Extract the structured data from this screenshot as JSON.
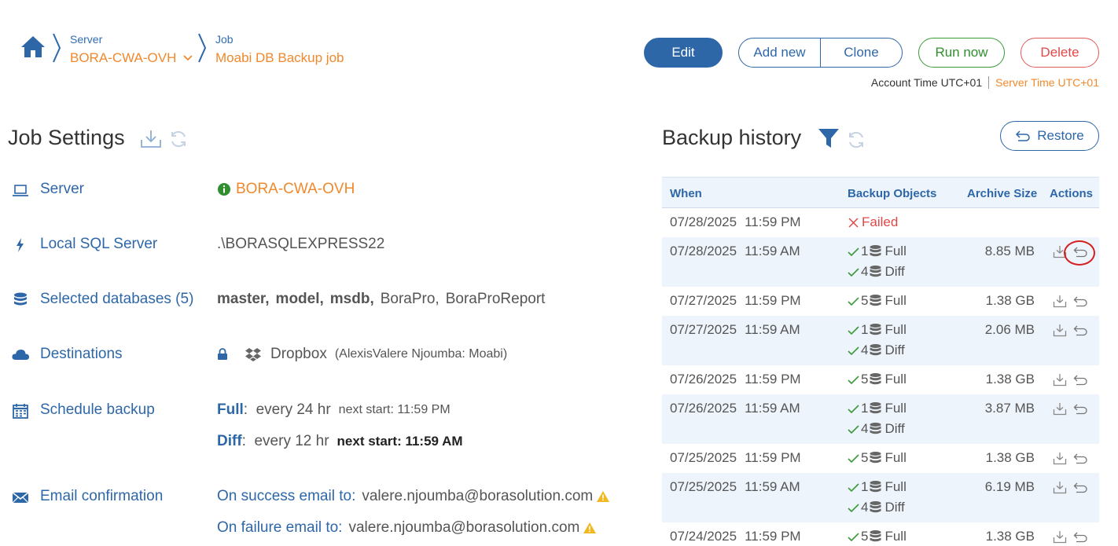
{
  "breadcrumb": {
    "server_caption": "Server",
    "server_name": "BORA-CWA-OVH",
    "job_caption": "Job",
    "job_name": "Moabi DB Backup job"
  },
  "toolbar": {
    "edit": "Edit",
    "add_new": "Add new",
    "clone": "Clone",
    "run_now": "Run now",
    "delete": "Delete"
  },
  "time": {
    "account": "Account Time UTC+01",
    "server": "Server Time UTC+01"
  },
  "settings": {
    "title": "Job Settings",
    "server_label": "Server",
    "server_value": "BORA-CWA-OVH",
    "sql_label": "Local SQL Server",
    "sql_value": ".\\BORASQLEXPRESS22",
    "db_label": "Selected databases (5)",
    "databases": [
      "master,",
      "model,",
      "msdb,",
      "BoraPro,",
      "BoraProReport"
    ],
    "dest_label": "Destinations",
    "dest_name": "Dropbox",
    "dest_account": "(AlexisValere Njoumba: Moabi)",
    "schedule_label": "Schedule backup",
    "full_label": "Full",
    "full_every": ":  every 24 hr",
    "full_next": "next start: 11:59 PM",
    "diff_label": "Diff",
    "diff_every": ":  every 12 hr",
    "diff_next": "next start: 11:59 AM",
    "email_label": "Email confirmation",
    "success_label": "On success email to:",
    "success_email": "valere.njoumba@borasolution.com",
    "failure_label": "On failure email to:",
    "failure_email": "valere.njoumba@borasolution.com"
  },
  "history": {
    "title": "Backup history",
    "restore": "Restore",
    "columns": [
      "When",
      "Backup Objects",
      "Archive Size",
      "Actions"
    ],
    "rows": [
      {
        "date": "07/28/2025",
        "time": "11:59 PM",
        "failed": "Failed"
      },
      {
        "date": "07/28/2025",
        "time": "11:59 AM",
        "n1": "1",
        "t1": "Full",
        "n2": "4",
        "t2": "Diff",
        "size": "8.85 MB"
      },
      {
        "date": "07/27/2025",
        "time": "11:59 PM",
        "n1": "5",
        "t1": "Full",
        "size": "1.38 GB"
      },
      {
        "date": "07/27/2025",
        "time": "11:59 AM",
        "n1": "1",
        "t1": "Full",
        "n2": "4",
        "t2": "Diff",
        "size": "2.06 MB"
      },
      {
        "date": "07/26/2025",
        "time": "11:59 PM",
        "n1": "5",
        "t1": "Full",
        "size": "1.38 GB"
      },
      {
        "date": "07/26/2025",
        "time": "11:59 AM",
        "n1": "1",
        "t1": "Full",
        "n2": "4",
        "t2": "Diff",
        "size": "3.87 MB"
      },
      {
        "date": "07/25/2025",
        "time": "11:59 PM",
        "n1": "5",
        "t1": "Full",
        "size": "1.38 GB"
      },
      {
        "date": "07/25/2025",
        "time": "11:59 AM",
        "n1": "1",
        "t1": "Full",
        "n2": "4",
        "t2": "Diff",
        "size": "6.19 MB"
      },
      {
        "date": "07/24/2025",
        "time": "11:59 PM",
        "n1": "5",
        "t1": "Full",
        "size": "1.38 GB"
      }
    ]
  },
  "colors": {
    "accent": "#2e67a8",
    "orange": "#f0892d",
    "success": "#2f8f2f",
    "danger": "#e04848",
    "row_alt": "#eef4fb"
  }
}
